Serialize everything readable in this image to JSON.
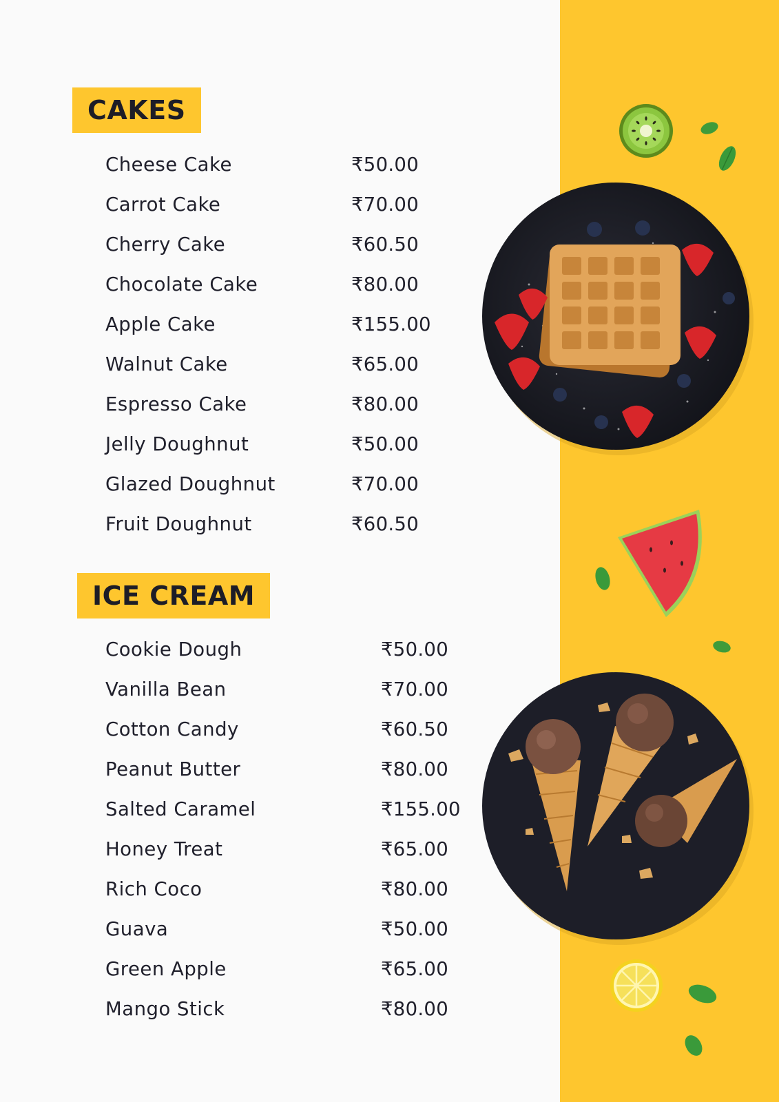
{
  "sections": [
    {
      "title": "CAKES",
      "items": [
        {
          "name": "Cheese Cake",
          "price": "₹50.00"
        },
        {
          "name": "Carrot Cake",
          "price": "₹70.00"
        },
        {
          "name": "Cherry Cake",
          "price": "₹60.50"
        },
        {
          "name": "Chocolate Cake",
          "price": "₹80.00"
        },
        {
          "name": "Apple Cake",
          "price": "₹155.00"
        },
        {
          "name": "Walnut Cake",
          "price": "₹65.00"
        },
        {
          "name": "Espresso Cake",
          "price": "₹80.00"
        },
        {
          "name": "Jelly Doughnut",
          "price": "₹50.00"
        },
        {
          "name": "Glazed Doughnut",
          "price": "₹70.00"
        },
        {
          "name": "Fruit Doughnut",
          "price": "₹60.50"
        }
      ]
    },
    {
      "title": "ICE CREAM",
      "items": [
        {
          "name": "Cookie Dough",
          "price": "₹50.00"
        },
        {
          "name": "Vanilla Bean",
          "price": "₹70.00"
        },
        {
          "name": "Cotton Candy",
          "price": "₹60.50"
        },
        {
          "name": "Peanut Butter",
          "price": "₹80.00"
        },
        {
          "name": "Salted Caramel",
          "price": "₹155.00"
        },
        {
          "name": "Honey Treat",
          "price": "₹65.00"
        },
        {
          "name": "Rich Coco",
          "price": "₹80.00"
        },
        {
          "name": "Guava",
          "price": "₹50.00"
        },
        {
          "name": "Green Apple",
          "price": "₹65.00"
        },
        {
          "name": "Mango Stick",
          "price": "₹80.00"
        }
      ]
    }
  ],
  "colors": {
    "accent": "#fec62e",
    "background": "#fafafa",
    "text": "#20202c",
    "plate": "#1c1d26"
  },
  "images": [
    "waffle-plate-image",
    "ice-cream-cones-plate-image",
    "kiwi-slice",
    "watermelon-slice",
    "lemon-slice",
    "mint-leaf"
  ]
}
